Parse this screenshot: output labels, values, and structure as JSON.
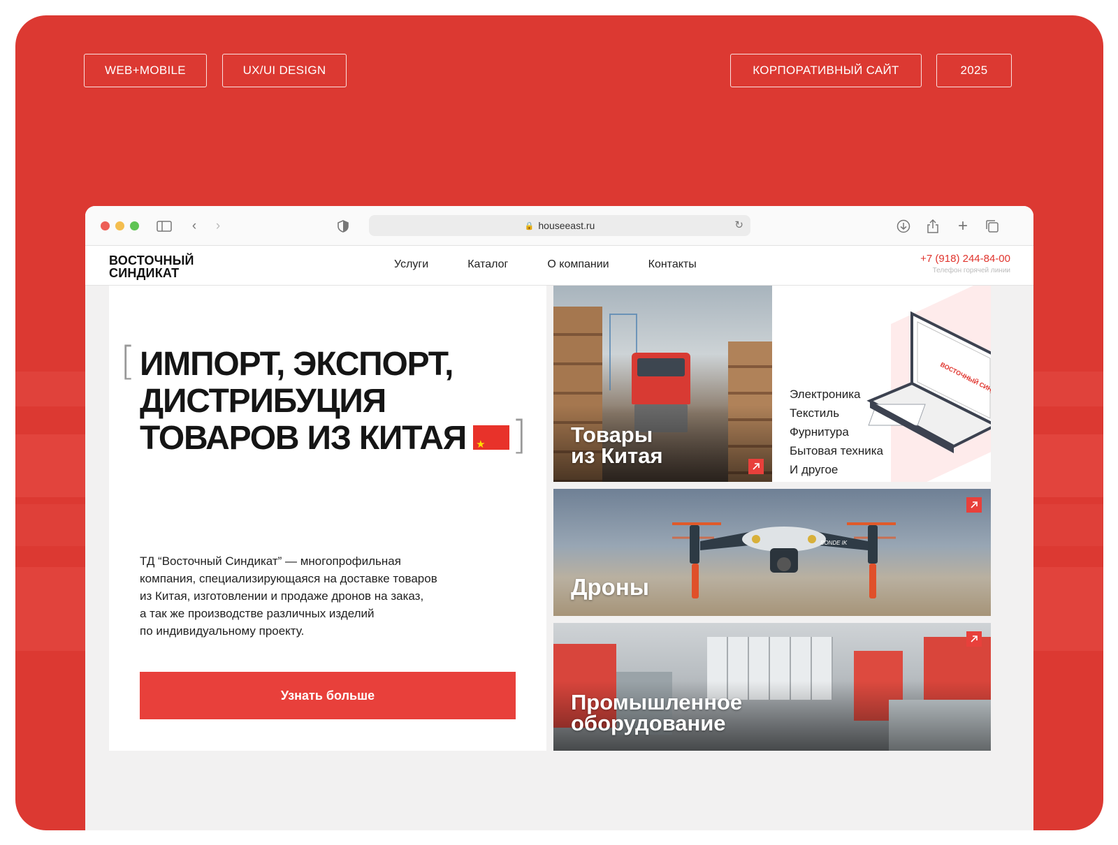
{
  "tags": {
    "platform": "WEB+MOBILE",
    "discipline": "UX/UI DESIGN",
    "type": "КОРПОРАТИВНЫЙ САЙТ",
    "year": "2025"
  },
  "browser": {
    "url": "houseeast.ru"
  },
  "site": {
    "logo_line1": "ВОСТОЧНЫЙ",
    "logo_line2": "СИНДИКАТ",
    "menu": [
      "Услуги",
      "Каталог",
      "О компании",
      "Контакты"
    ],
    "phone": "+7 (918) 244-84-00",
    "phone_caption": "Телефон горячей линии"
  },
  "hero": {
    "title_line1": "ИМПОРТ, ЭКСПОРТ,",
    "title_line2": "ДИСТРИБУЦИЯ",
    "title_line3": "ТОВАРОВ ИЗ КИТАЯ",
    "bracket_open": "[",
    "bracket_close": "]",
    "description_lines": [
      "ТД “Восточный Синдикат” — многопрофильная",
      "компания, специализирующаяся на доставке товаров",
      "из Китая, изготовлении и продаже дронов на заказ,",
      "а так же производстве различных изделий",
      "по индивидуальному проекту."
    ],
    "cta_label": "Узнать больше"
  },
  "tiles": {
    "goods_line1": "Товары",
    "goods_line2": "из Китая",
    "goods_list": [
      "Электроника",
      "Текстиль",
      "Фурнитура",
      "Бытовая техника",
      "И другое"
    ],
    "laptop_logo": "ВОСТОЧНЫЙ СИНДИКАТ",
    "drones": "Дроны",
    "drone_brand": "BONDE IK",
    "equipment_line1": "Промышленное",
    "equipment_line2": "оборудование"
  },
  "colors": {
    "brand_red": "#dc3932",
    "accent": "#e8403b"
  }
}
